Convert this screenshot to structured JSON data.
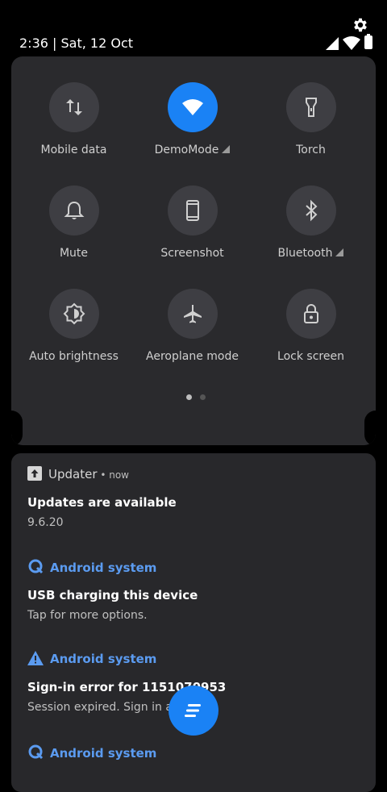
{
  "status_bar": {
    "time_date": "2:36 | Sat, 12 Oct",
    "icons": [
      "settings-gear-icon",
      "cell-signal-icon",
      "wifi-icon",
      "battery-icon"
    ]
  },
  "quick_settings": {
    "tiles": [
      {
        "label": "Mobile data",
        "icon": "mobile-data-icon",
        "active": false
      },
      {
        "label": "DemoMode",
        "icon": "wifi-icon",
        "active": true,
        "has_arrow": true
      },
      {
        "label": "Torch",
        "icon": "torch-icon",
        "active": false
      },
      {
        "label": "Mute",
        "icon": "bell-icon",
        "active": false
      },
      {
        "label": "Screenshot",
        "icon": "phone-icon",
        "active": false
      },
      {
        "label": "Bluetooth",
        "icon": "bluetooth-icon",
        "active": false,
        "has_arrow": true
      },
      {
        "label": "Auto brightness",
        "icon": "brightness-icon",
        "active": false
      },
      {
        "label": "Aeroplane mode",
        "icon": "airplane-icon",
        "active": false
      },
      {
        "label": "Lock screen",
        "icon": "lock-icon",
        "active": false
      }
    ],
    "page_indicator": {
      "pages": 2,
      "current": 1
    },
    "accent_color": "#1a82f5"
  },
  "notifications": [
    {
      "app": "Updater",
      "time": "now",
      "title": "Updates are available",
      "body": "9.6.20"
    },
    {
      "app": "Android system",
      "title": "USB charging this device",
      "body": "Tap for more options."
    },
    {
      "app": "Android system",
      "title": "Sign-in error for 1151070953",
      "body": "Session expired. Sign in again."
    },
    {
      "app": "Android system"
    }
  ]
}
